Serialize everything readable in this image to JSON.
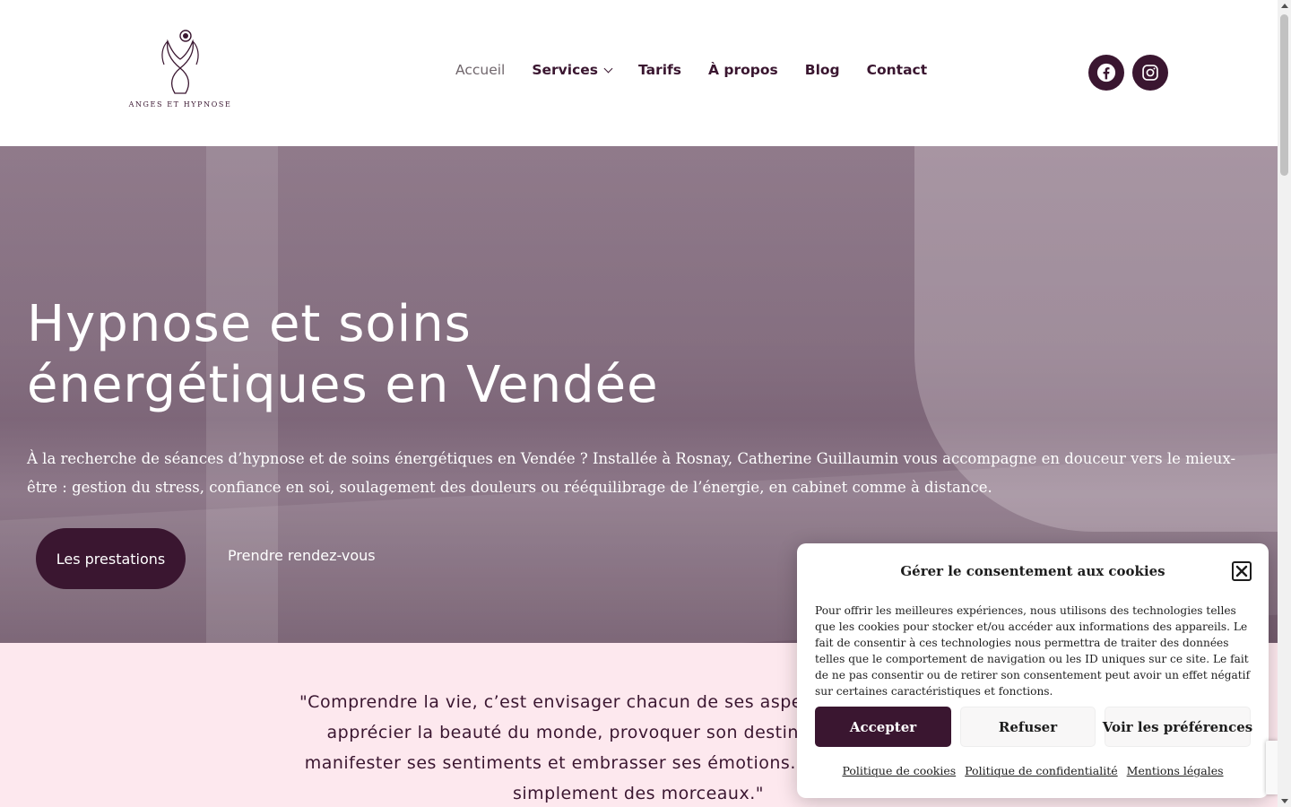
{
  "header": {
    "logo_text": "ANGES ET HYPNOSE",
    "nav": [
      {
        "label": "Accueil"
      },
      {
        "label": "Services"
      },
      {
        "label": "Tarifs"
      },
      {
        "label": "À propos"
      },
      {
        "label": "Blog"
      },
      {
        "label": "Contact"
      }
    ],
    "social": [
      "facebook-icon",
      "instagram-icon"
    ]
  },
  "hero": {
    "title_line1": "Hypnose et soins",
    "title_line2": "énergétiques en Vendée",
    "text": "À la recherche de séances d’hypnose et de soins énergétiques en Vendée ? Installée à Rosnay, Catherine Guillaumin vous accompagne en douceur vers le mieux-être : gestion du stress, confiance en soi, soulagement des douleurs ou rééquilibrage de l’énergie, en cabinet comme à distance.",
    "primary_button": "Les prestations",
    "secondary_button": "Prendre rendez-vous"
  },
  "quote": {
    "line1": "\"Comprendre la vie, c’est envisager chacun de ses aspects. C’est prendre c",
    "line2": "apprécier la beauté du monde, provoquer son destin, accepter la dou",
    "line3": "manifester ses sentiments et embrasser ses émotions. On embarque dans",
    "line4": "simplement des morceaux.\""
  },
  "cookie": {
    "title": "Gérer le consentement aux cookies",
    "text": "Pour offrir les meilleures expériences, nous utilisons des technologies telles que les cookies pour stocker et/ou accéder aux informations des appareils. Le fait de consentir à ces technologies nous permettra de traiter des données telles que le comportement de navigation ou les ID uniques sur ce site. Le fait de ne pas consentir ou de retirer son consentement peut avoir un effet négatif sur certaines caractéristiques et fonctions.",
    "accept": "Accepter",
    "refuse": "Refuser",
    "preferences": "Voir les préférences",
    "links": [
      "Politique de cookies",
      "Politique de confidentialité",
      "Mentions légales"
    ]
  },
  "colors": {
    "brand": "#3a1630",
    "quote_bg": "#fde8ee",
    "hero_overlay": "#5c3c56"
  }
}
